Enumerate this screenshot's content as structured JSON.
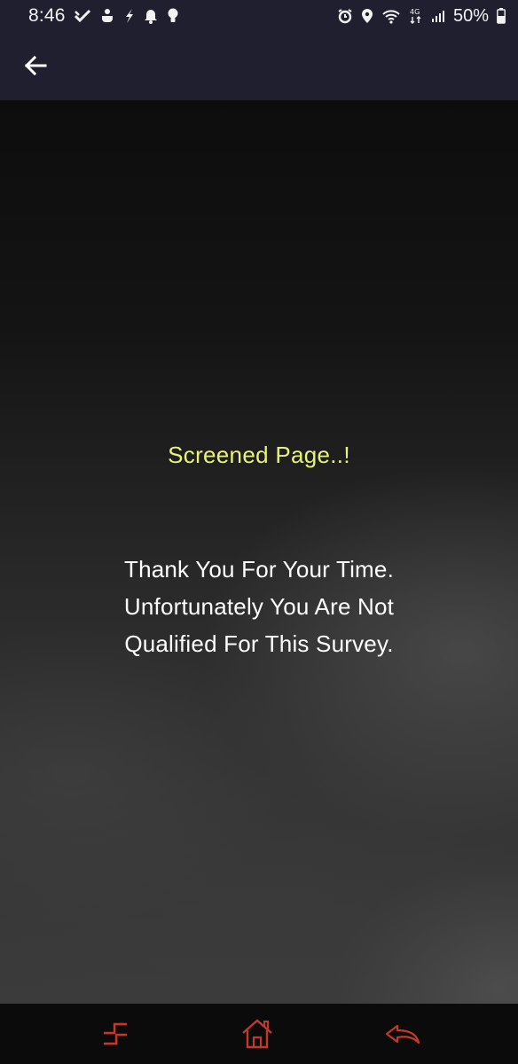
{
  "status_bar": {
    "time": "8:46",
    "left_icons": [
      "check-icon",
      "tea-icon",
      "bolt-feather-icon",
      "bell-icon",
      "lightbulb-icon"
    ],
    "right_icons": [
      "alarm-icon",
      "location-icon",
      "wifi-icon",
      "data-4g-icon",
      "signal-icon"
    ],
    "battery_percent": "50%"
  },
  "app_bar": {
    "back_icon": "arrow-left-icon"
  },
  "content": {
    "title": "Screened Page..!",
    "message_lines": [
      "Thank You For Your Time.",
      "Unfortunately You Are Not",
      "Qualified For This Survey."
    ]
  },
  "bottom_nav": {
    "items": [
      "recent-apps-icon",
      "home-icon",
      "back-icon"
    ],
    "icon_color": "#c0392b"
  },
  "colors": {
    "bar_background": "#1f1f30",
    "title": "#e7f27a",
    "message": "#ffffff"
  }
}
